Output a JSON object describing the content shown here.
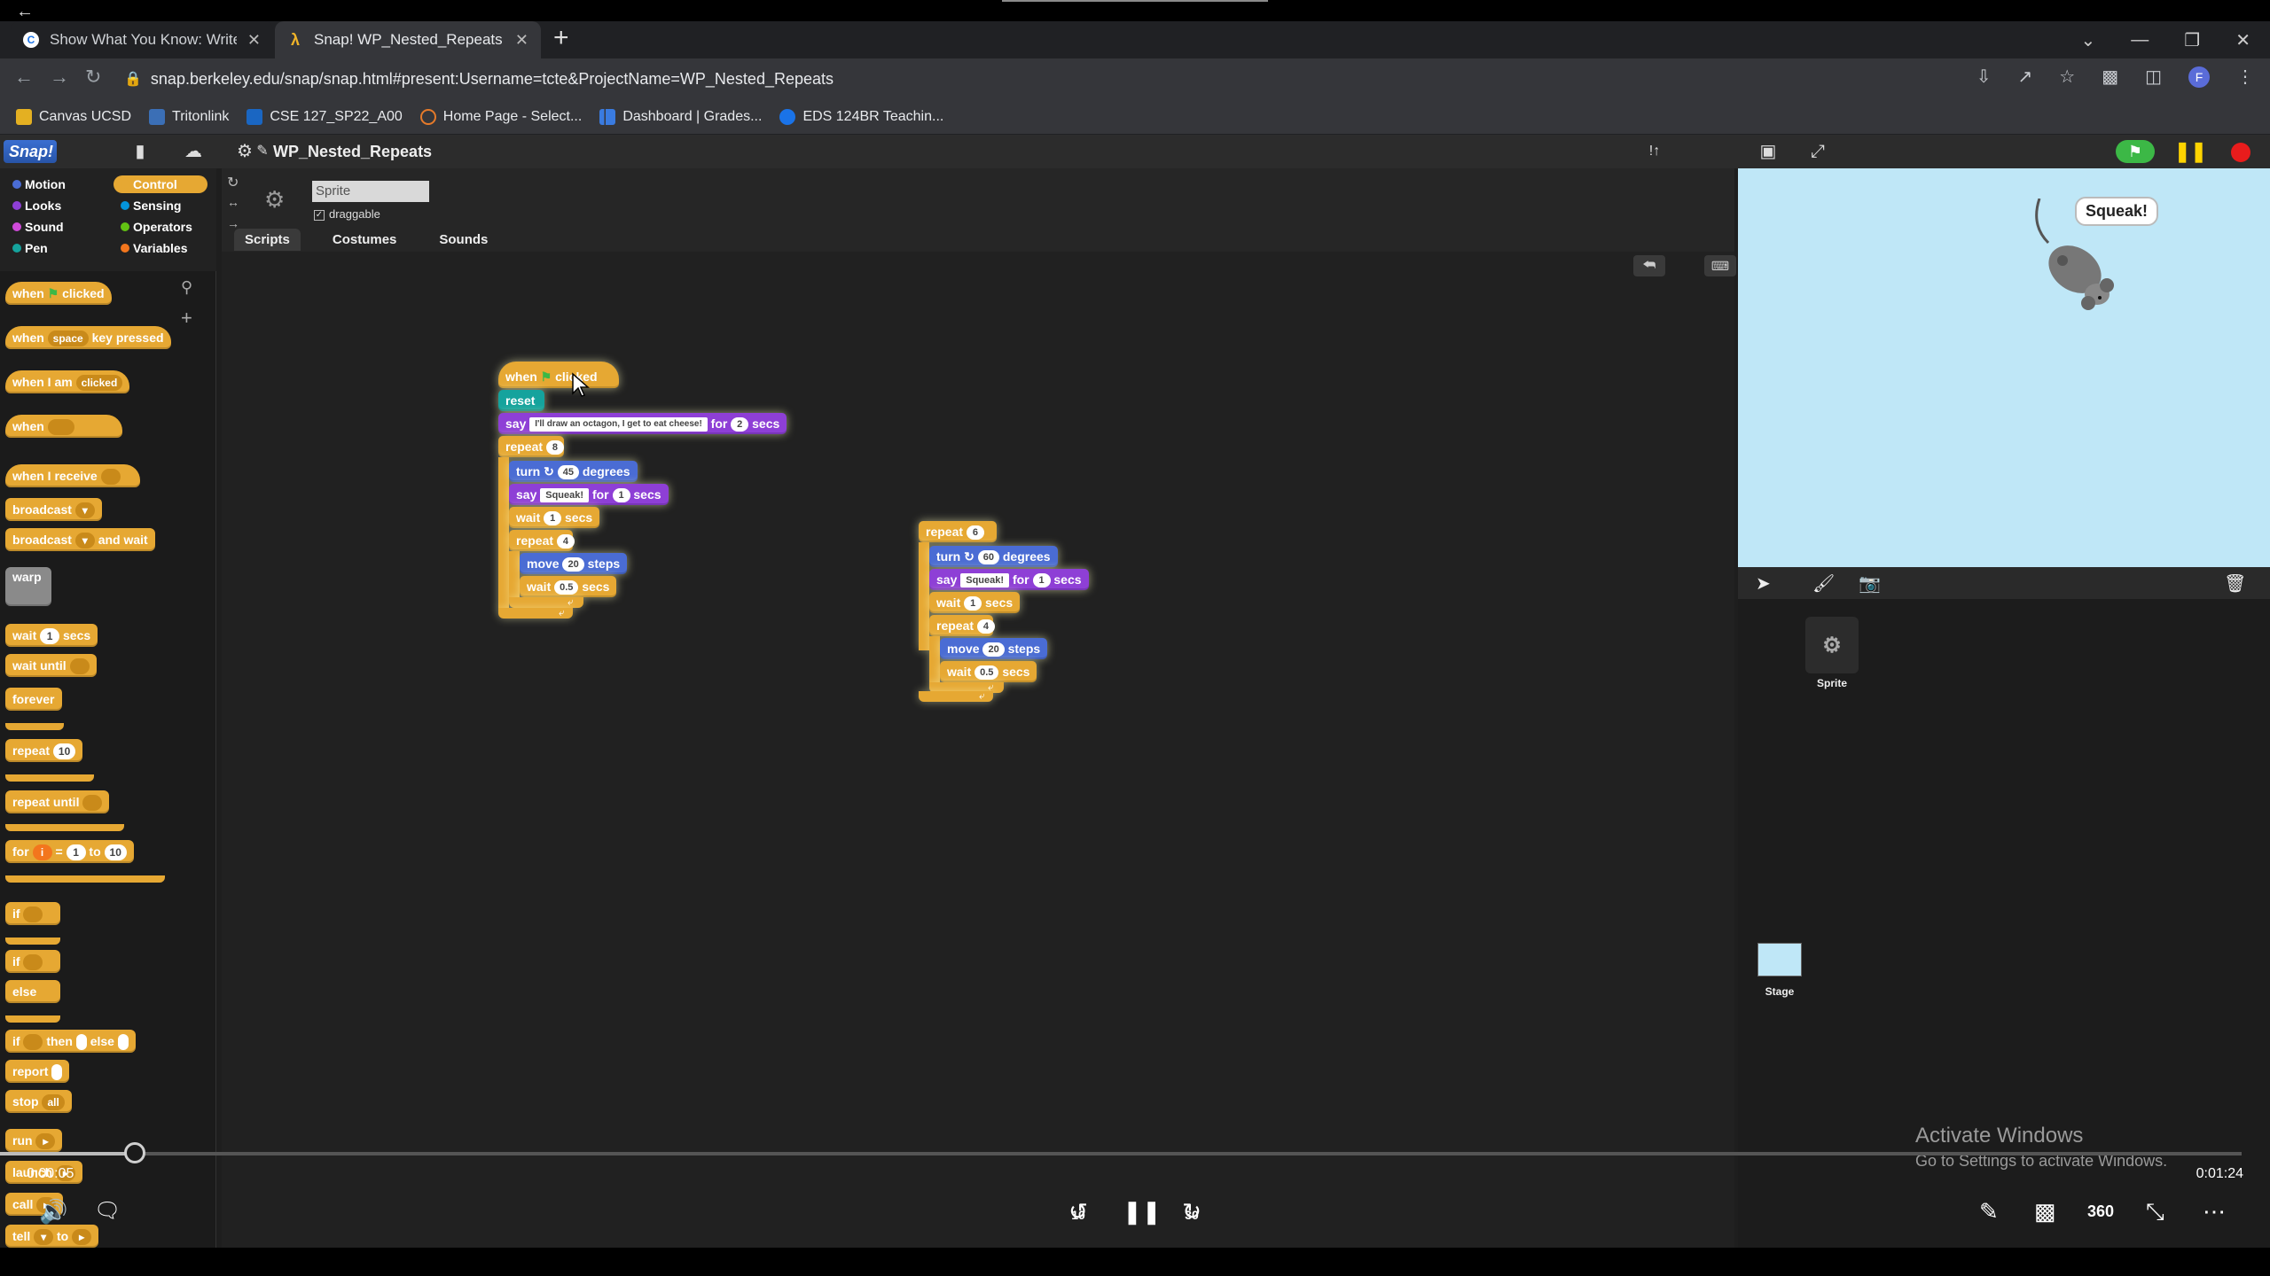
{
  "browser": {
    "tabs": [
      {
        "title": "Show What You Know: Write and",
        "active": false
      },
      {
        "title": "Snap! WP_Nested_Repeats",
        "active": true
      }
    ],
    "url": "snap.berkeley.edu/snap/snap.html#present:Username=tcte&ProjectName=WP_Nested_Repeats",
    "profile_initial": "F",
    "bookmarks": [
      "Canvas UCSD",
      "Tritonlink",
      "CSE 127_SP22_A00",
      "Home Page - Select...",
      "Dashboard | Grades...",
      "EDS 124BR Teachin..."
    ]
  },
  "snap": {
    "logo": "Snap!",
    "project_name": "WP_Nested_Repeats",
    "categories": {
      "left": [
        "Motion",
        "Looks",
        "Sound",
        "Pen"
      ],
      "right": [
        "Control",
        "Sensing",
        "Operators",
        "Variables"
      ],
      "active": "Control"
    },
    "category_colors": {
      "Motion": "#4a6cd4",
      "Looks": "#8e3fd6",
      "Sound": "#cf4ad9",
      "Pen": "#15a39d",
      "Control": "#e6a833",
      "Sensing": "#0494dc",
      "Operators": "#62c213",
      "Variables": "#f3761d"
    },
    "palette": {
      "when_clicked": [
        "when",
        "clicked"
      ],
      "when_key": [
        "when",
        "space",
        "key pressed"
      ],
      "when_i_am": [
        "when I am",
        "clicked"
      ],
      "when": "when",
      "when_receive": "when I receive",
      "broadcast": "broadcast",
      "broadcast_wait": [
        "broadcast",
        "and wait"
      ],
      "warp": "warp",
      "wait": [
        "wait",
        "1",
        "secs"
      ],
      "wait_until": "wait until",
      "forever": "forever",
      "repeat": [
        "repeat",
        "10"
      ],
      "repeat_until": "repeat until",
      "for": [
        "for",
        "i",
        "=",
        "1",
        "to",
        "10"
      ],
      "if": "if",
      "if_else": [
        "if",
        "else"
      ],
      "if_then_else": [
        "if",
        "then",
        "else"
      ],
      "report": "report",
      "stop": [
        "stop",
        "all"
      ],
      "run": "run",
      "launch": "launch",
      "call": "call",
      "tell": [
        "tell",
        "to"
      ]
    },
    "sprite": {
      "name": "Sprite",
      "draggable_label": "draggable",
      "tabs": [
        "Scripts",
        "Costumes",
        "Sounds"
      ]
    },
    "script1": {
      "hat": [
        "when",
        "clicked"
      ],
      "reset": "reset",
      "say1": [
        "say",
        "I'll draw an octagon, I get to eat cheese!",
        "for",
        "2",
        "secs"
      ],
      "repeat_outer": [
        "repeat",
        "8"
      ],
      "turn": [
        "turn",
        "45",
        "degrees"
      ],
      "say2": [
        "say",
        "Squeak!",
        "for",
        "1",
        "secs"
      ],
      "wait1": [
        "wait",
        "1",
        "secs"
      ],
      "repeat_inner": [
        "repeat",
        "4"
      ],
      "move": [
        "move",
        "20",
        "steps"
      ],
      "wait2": [
        "wait",
        "0.5",
        "secs"
      ]
    },
    "script2": {
      "repeat_outer": [
        "repeat",
        "6"
      ],
      "turn": [
        "turn",
        "60",
        "degrees"
      ],
      "say": [
        "say",
        "Squeak!",
        "for",
        "1",
        "secs"
      ],
      "wait1": [
        "wait",
        "1",
        "secs"
      ],
      "repeat_inner": [
        "repeat",
        "4"
      ],
      "move": [
        "move",
        "20",
        "steps"
      ],
      "wait2": [
        "wait",
        "0.5",
        "secs"
      ]
    },
    "stage": {
      "speech": "Squeak!",
      "sprite_label": "Sprite",
      "stage_label": "Stage",
      "background": "#bfe7f7"
    }
  },
  "activate_windows": {
    "title": "Activate Windows",
    "subtitle": "Go to Settings to activate Windows."
  },
  "video": {
    "current_time": "0:00:05",
    "total_time": "0:01:24",
    "progress_percent": 6,
    "rewind_seconds": "10",
    "forward_seconds": "30"
  }
}
